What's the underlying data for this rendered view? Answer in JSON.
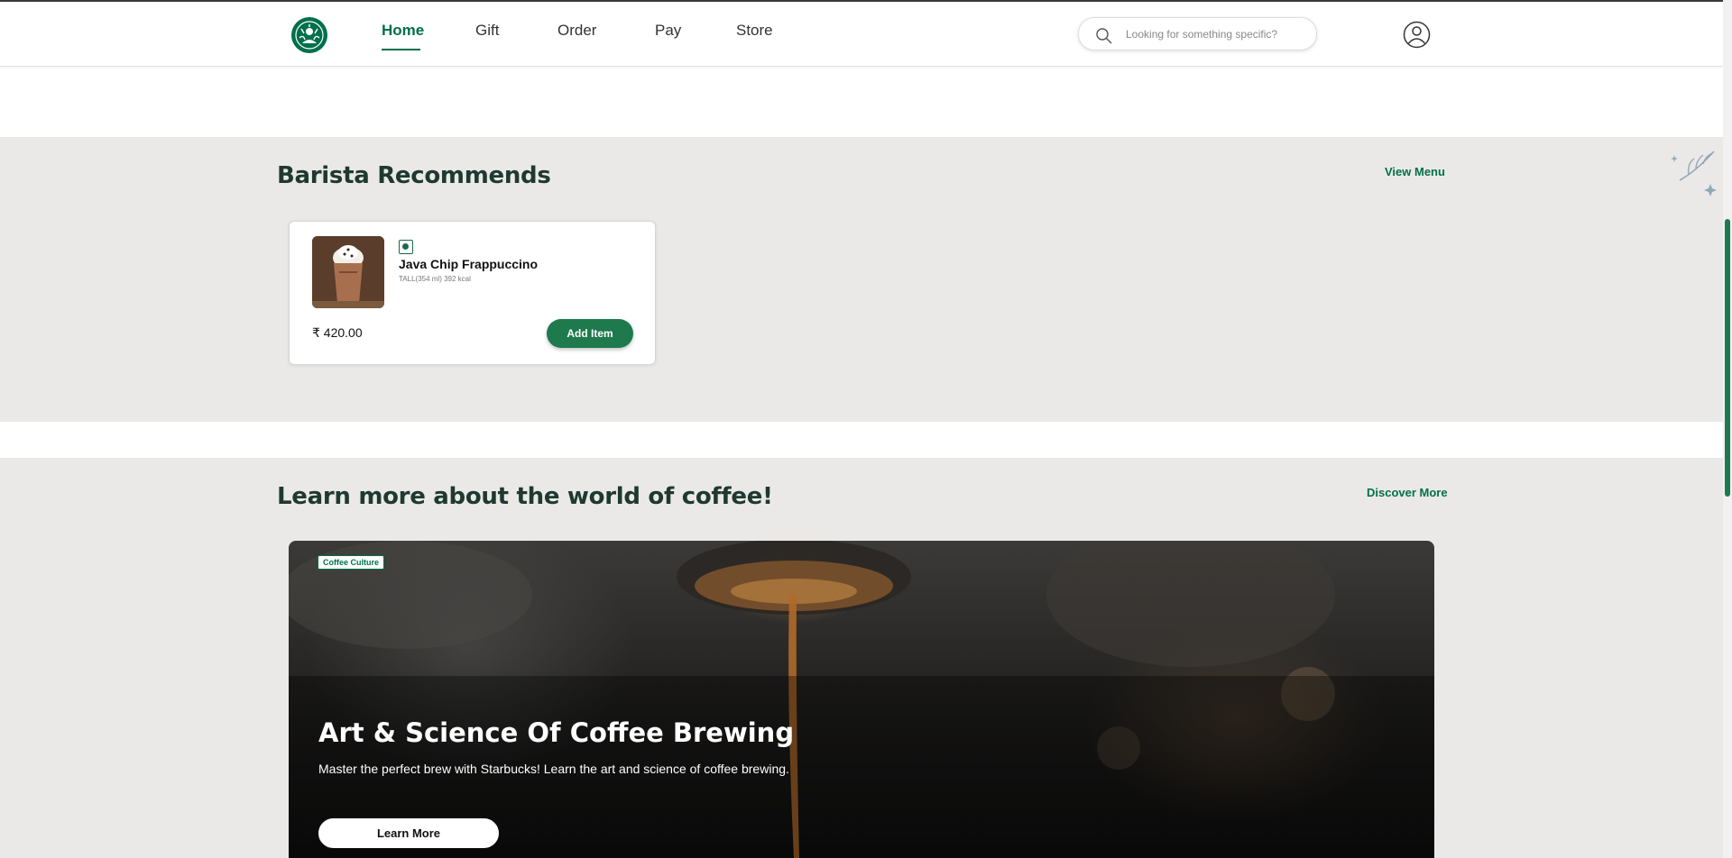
{
  "header": {
    "logo_icon": "starbucks-siren-logo",
    "nav": [
      {
        "label": "Home",
        "active": true
      },
      {
        "label": "Gift",
        "active": false
      },
      {
        "label": "Order",
        "active": false
      },
      {
        "label": "Pay",
        "active": false
      },
      {
        "label": "Store",
        "active": false
      }
    ],
    "search": {
      "placeholder": "Looking for something specific?",
      "value": "",
      "icon": "search-icon"
    },
    "profile_icon": "user-profile-icon"
  },
  "barista": {
    "title": "Barista Recommends",
    "link": "View Menu",
    "product": {
      "name": "Java Chip Frappuccino",
      "meta": "TALL(354 ml) 392 kcal",
      "price": "₹ 420.00",
      "add_label": "Add Item",
      "veg_icon": "veg-indicator-icon"
    }
  },
  "learn": {
    "title": "Learn more about the world of coffee!",
    "link": "Discover More",
    "hero": {
      "tag": "Coffee Culture",
      "title": "Art & Science Of Coffee Brewing",
      "description": "Master the perfect brew with Starbucks! Learn the art and science of coffee brewing.",
      "button": "Learn More"
    }
  },
  "colors": {
    "accent": "#00704a",
    "button": "#1e7a4d",
    "section_bg": "#ebe9e7",
    "heading": "#1e3932"
  }
}
